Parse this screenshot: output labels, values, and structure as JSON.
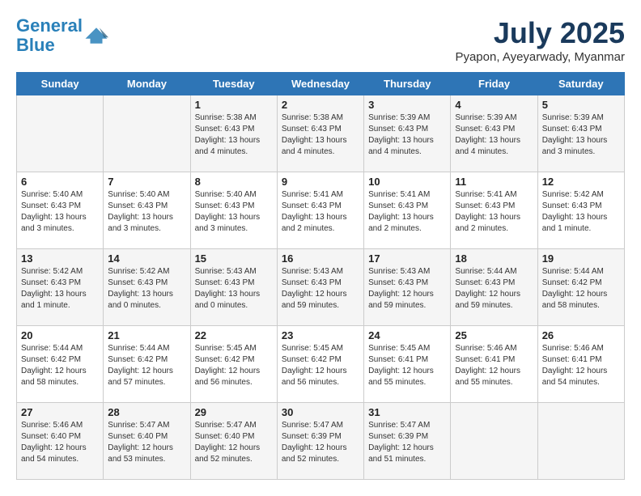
{
  "logo": {
    "line1": "General",
    "line2": "Blue"
  },
  "title": "July 2025",
  "location": "Pyapon, Ayeyarwady, Myanmar",
  "days_header": [
    "Sunday",
    "Monday",
    "Tuesday",
    "Wednesday",
    "Thursday",
    "Friday",
    "Saturday"
  ],
  "weeks": [
    [
      {
        "day": "",
        "info": ""
      },
      {
        "day": "",
        "info": ""
      },
      {
        "day": "1",
        "info": "Sunrise: 5:38 AM\nSunset: 6:43 PM\nDaylight: 13 hours and 4 minutes."
      },
      {
        "day": "2",
        "info": "Sunrise: 5:38 AM\nSunset: 6:43 PM\nDaylight: 13 hours and 4 minutes."
      },
      {
        "day": "3",
        "info": "Sunrise: 5:39 AM\nSunset: 6:43 PM\nDaylight: 13 hours and 4 minutes."
      },
      {
        "day": "4",
        "info": "Sunrise: 5:39 AM\nSunset: 6:43 PM\nDaylight: 13 hours and 4 minutes."
      },
      {
        "day": "5",
        "info": "Sunrise: 5:39 AM\nSunset: 6:43 PM\nDaylight: 13 hours and 3 minutes."
      }
    ],
    [
      {
        "day": "6",
        "info": "Sunrise: 5:40 AM\nSunset: 6:43 PM\nDaylight: 13 hours and 3 minutes."
      },
      {
        "day": "7",
        "info": "Sunrise: 5:40 AM\nSunset: 6:43 PM\nDaylight: 13 hours and 3 minutes."
      },
      {
        "day": "8",
        "info": "Sunrise: 5:40 AM\nSunset: 6:43 PM\nDaylight: 13 hours and 3 minutes."
      },
      {
        "day": "9",
        "info": "Sunrise: 5:41 AM\nSunset: 6:43 PM\nDaylight: 13 hours and 2 minutes."
      },
      {
        "day": "10",
        "info": "Sunrise: 5:41 AM\nSunset: 6:43 PM\nDaylight: 13 hours and 2 minutes."
      },
      {
        "day": "11",
        "info": "Sunrise: 5:41 AM\nSunset: 6:43 PM\nDaylight: 13 hours and 2 minutes."
      },
      {
        "day": "12",
        "info": "Sunrise: 5:42 AM\nSunset: 6:43 PM\nDaylight: 13 hours and 1 minute."
      }
    ],
    [
      {
        "day": "13",
        "info": "Sunrise: 5:42 AM\nSunset: 6:43 PM\nDaylight: 13 hours and 1 minute."
      },
      {
        "day": "14",
        "info": "Sunrise: 5:42 AM\nSunset: 6:43 PM\nDaylight: 13 hours and 0 minutes."
      },
      {
        "day": "15",
        "info": "Sunrise: 5:43 AM\nSunset: 6:43 PM\nDaylight: 13 hours and 0 minutes."
      },
      {
        "day": "16",
        "info": "Sunrise: 5:43 AM\nSunset: 6:43 PM\nDaylight: 12 hours and 59 minutes."
      },
      {
        "day": "17",
        "info": "Sunrise: 5:43 AM\nSunset: 6:43 PM\nDaylight: 12 hours and 59 minutes."
      },
      {
        "day": "18",
        "info": "Sunrise: 5:44 AM\nSunset: 6:43 PM\nDaylight: 12 hours and 59 minutes."
      },
      {
        "day": "19",
        "info": "Sunrise: 5:44 AM\nSunset: 6:42 PM\nDaylight: 12 hours and 58 minutes."
      }
    ],
    [
      {
        "day": "20",
        "info": "Sunrise: 5:44 AM\nSunset: 6:42 PM\nDaylight: 12 hours and 58 minutes."
      },
      {
        "day": "21",
        "info": "Sunrise: 5:44 AM\nSunset: 6:42 PM\nDaylight: 12 hours and 57 minutes."
      },
      {
        "day": "22",
        "info": "Sunrise: 5:45 AM\nSunset: 6:42 PM\nDaylight: 12 hours and 56 minutes."
      },
      {
        "day": "23",
        "info": "Sunrise: 5:45 AM\nSunset: 6:42 PM\nDaylight: 12 hours and 56 minutes."
      },
      {
        "day": "24",
        "info": "Sunrise: 5:45 AM\nSunset: 6:41 PM\nDaylight: 12 hours and 55 minutes."
      },
      {
        "day": "25",
        "info": "Sunrise: 5:46 AM\nSunset: 6:41 PM\nDaylight: 12 hours and 55 minutes."
      },
      {
        "day": "26",
        "info": "Sunrise: 5:46 AM\nSunset: 6:41 PM\nDaylight: 12 hours and 54 minutes."
      }
    ],
    [
      {
        "day": "27",
        "info": "Sunrise: 5:46 AM\nSunset: 6:40 PM\nDaylight: 12 hours and 54 minutes."
      },
      {
        "day": "28",
        "info": "Sunrise: 5:47 AM\nSunset: 6:40 PM\nDaylight: 12 hours and 53 minutes."
      },
      {
        "day": "29",
        "info": "Sunrise: 5:47 AM\nSunset: 6:40 PM\nDaylight: 12 hours and 52 minutes."
      },
      {
        "day": "30",
        "info": "Sunrise: 5:47 AM\nSunset: 6:39 PM\nDaylight: 12 hours and 52 minutes."
      },
      {
        "day": "31",
        "info": "Sunrise: 5:47 AM\nSunset: 6:39 PM\nDaylight: 12 hours and 51 minutes."
      },
      {
        "day": "",
        "info": ""
      },
      {
        "day": "",
        "info": ""
      }
    ]
  ]
}
